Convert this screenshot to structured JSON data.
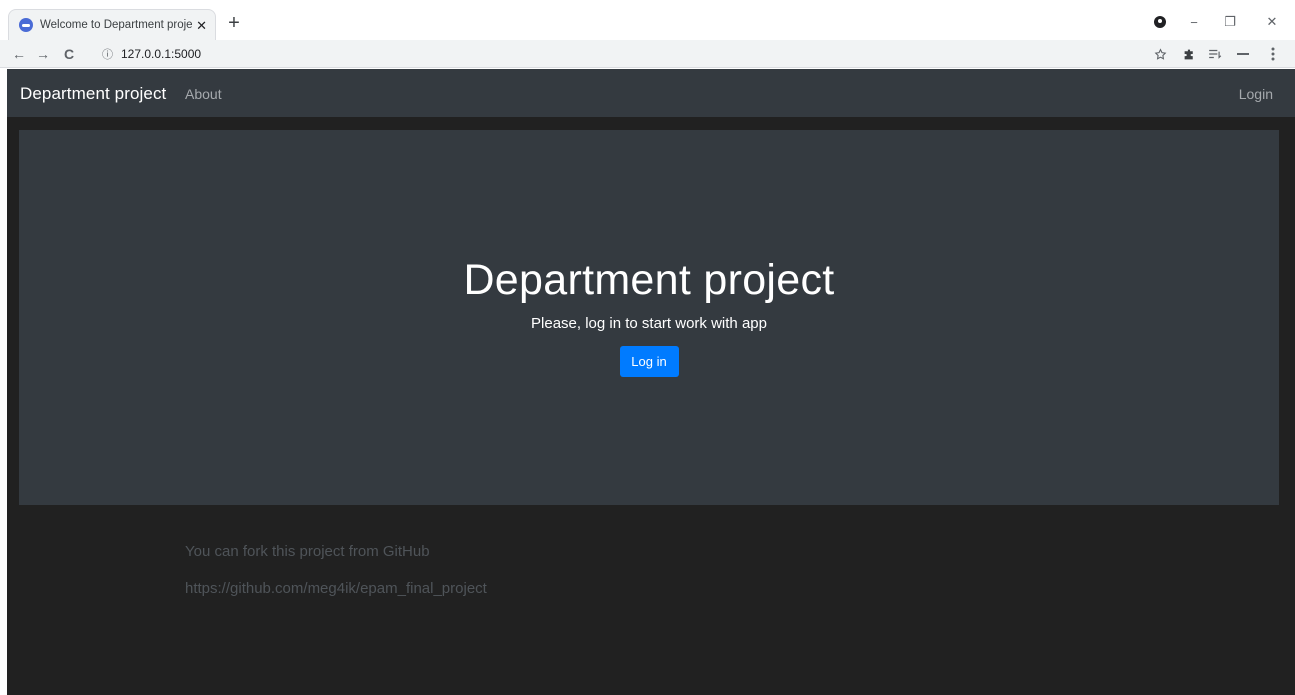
{
  "browser": {
    "tab": {
      "title": "Welcome to Department project",
      "close": "✕"
    },
    "new_tab": "+",
    "url": "127.0.0.1:5000",
    "info_glyph": "ⓘ",
    "nav": {
      "back": "←",
      "forward": "→",
      "reload": "C"
    },
    "icons": [
      "star-icon",
      "puzzle-icon",
      "reading-list-icon",
      "minimize-icon",
      "menu-icon"
    ],
    "window_controls": {
      "minimize": "−",
      "restore": "❐",
      "close": "✕"
    }
  },
  "page": {
    "navbar": {
      "brand": "Department project",
      "about": "About",
      "login": "Login"
    },
    "jumbotron": {
      "title": "Department project",
      "lead": "Please, log in to start work with app",
      "button": "Log in"
    },
    "footer": {
      "line1": "You can fork this project from GitHub",
      "line2": "https://github.com/meg4ik/epam_final_project"
    },
    "colors": {
      "background": "#212121",
      "navbar": "#343a40",
      "accent": "#007bff",
      "muted_text": "#4f5459"
    }
  }
}
